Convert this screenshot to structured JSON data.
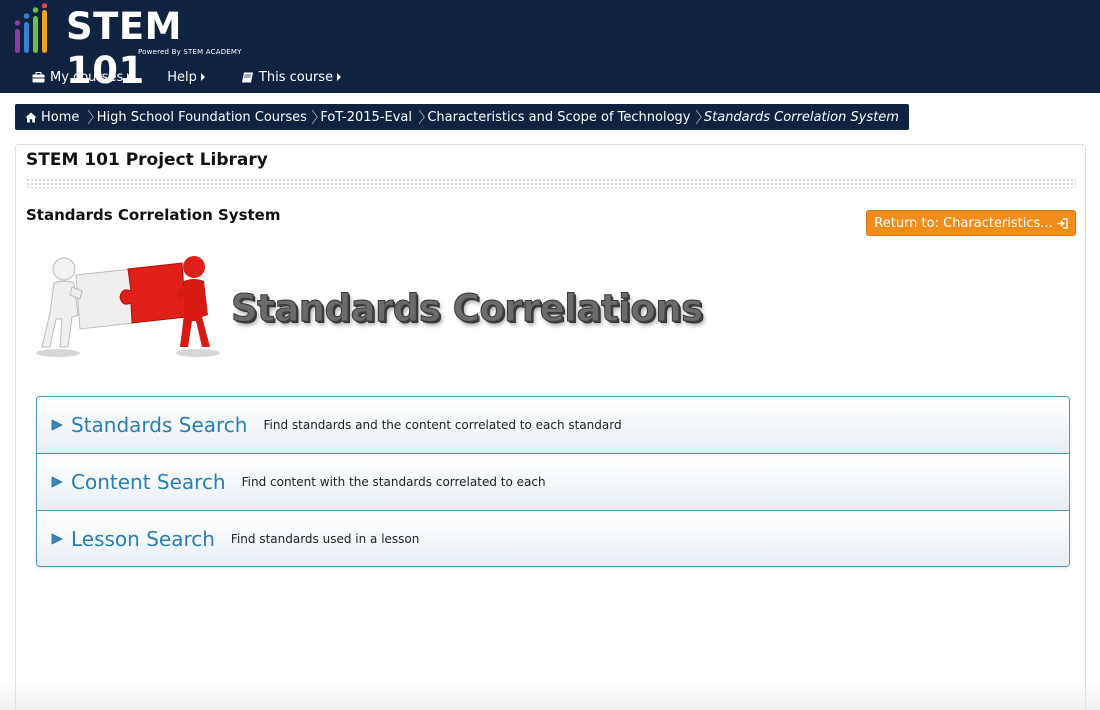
{
  "header": {
    "logo_text": "STEM 101",
    "logo_sub": "Powered By STEM ACADEMY",
    "nav": [
      {
        "label": "My courses",
        "icon": "briefcase-icon"
      },
      {
        "label": "Help",
        "icon": ""
      },
      {
        "label": "This course",
        "icon": "book-icon"
      }
    ]
  },
  "breadcrumb": [
    {
      "label": "Home",
      "icon": "home-icon"
    },
    {
      "label": "High School Foundation Courses"
    },
    {
      "label": "FoT-2015-Eval"
    },
    {
      "label": "Characteristics and Scope of Technology"
    },
    {
      "label": "Standards Correlation System",
      "current": true
    }
  ],
  "main": {
    "title": "STEM 101 Project Library",
    "section_title": "Standards Correlation System",
    "return_button": "Return to: Characteristics...",
    "banner_text": "Standards Correlations",
    "searches": [
      {
        "title": "Standards Search",
        "desc": "Find standards and the content correlated to each standard"
      },
      {
        "title": "Content Search",
        "desc": "Find content with the standards correlated to each"
      },
      {
        "title": "Lesson Search",
        "desc": "Find standards used in a lesson"
      }
    ]
  },
  "colors": {
    "header_bg": "#0f2340",
    "accent_orange": "#f28c1b",
    "link_blue": "#2a7fb0",
    "row_border": "#4a98c5"
  }
}
